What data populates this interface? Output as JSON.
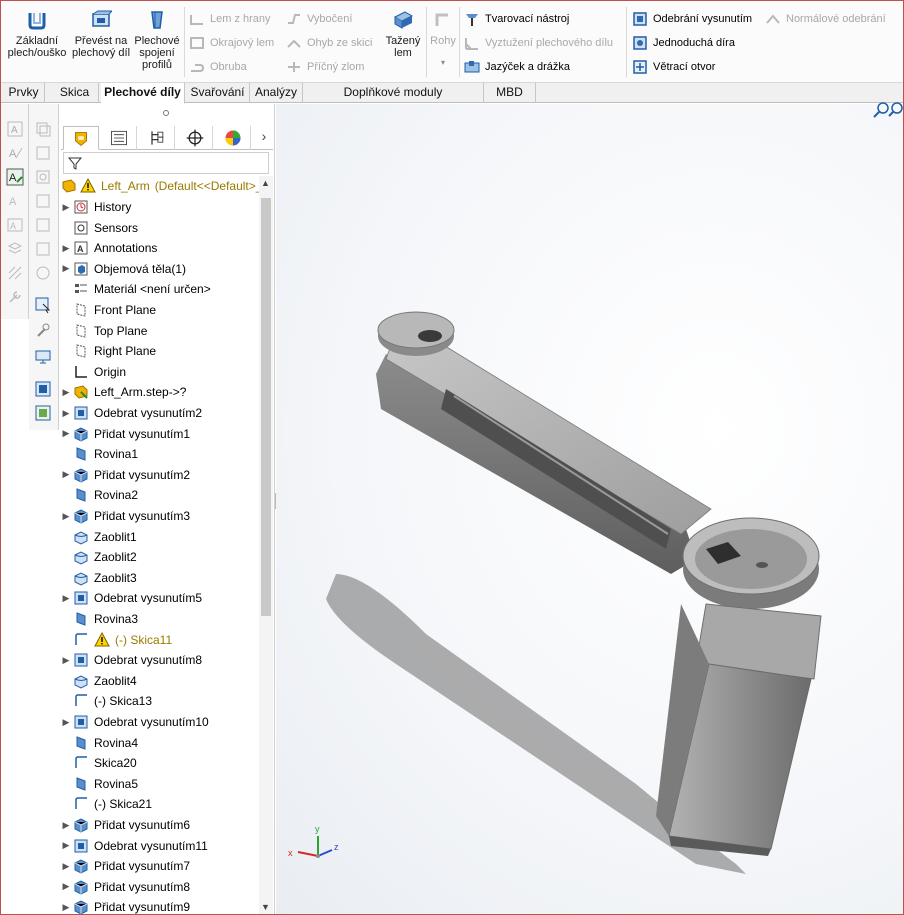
{
  "ribbon": {
    "big_buttons": [
      {
        "label": "Základní plech/ouško",
        "icon": "base-flange-icon"
      },
      {
        "label": "Převést na plechový díl",
        "icon": "convert-to-sheet-metal-icon"
      },
      {
        "label": "Plechové spojení profilů",
        "icon": "lofted-bend-icon"
      }
    ],
    "group1": [
      {
        "label": "Lem z hrany",
        "icon": "edge-flange-icon",
        "enabled": false
      },
      {
        "label": "Okrajový lem",
        "icon": "miter-flange-icon",
        "enabled": false
      },
      {
        "label": "Obruba",
        "icon": "hem-icon",
        "enabled": false
      }
    ],
    "group2": [
      {
        "label": "Vybočení",
        "icon": "jog-icon",
        "enabled": false
      },
      {
        "label": "Ohyb ze skici",
        "icon": "sketched-bend-icon",
        "enabled": false
      },
      {
        "label": "Příčný zlom",
        "icon": "cross-break-icon",
        "enabled": false
      }
    ],
    "tazeny_lem": {
      "label": "Tažený lem",
      "icon": "swept-flange-icon"
    },
    "rohy": {
      "label": "Rohy",
      "icon": "corners-icon",
      "enabled": false
    },
    "group3": [
      {
        "label": "Tvarovací nástroj",
        "icon": "forming-tool-icon",
        "enabled": true
      },
      {
        "label": "Vyztužení plechového dílu",
        "icon": "sheet-metal-gusset-icon",
        "enabled": false
      },
      {
        "label": "Jazýček a drážka",
        "icon": "tab-and-slot-icon",
        "enabled": true
      }
    ],
    "group4": [
      {
        "label": "Odebrání vysunutím",
        "icon": "extruded-cut-icon",
        "enabled": true
      },
      {
        "label": "Jednoduchá díra",
        "icon": "simple-hole-icon",
        "enabled": true
      },
      {
        "label": "Větrací otvor",
        "icon": "vent-icon",
        "enabled": true
      }
    ],
    "normal_cut": {
      "label": "Normálové odebrání",
      "icon": "normal-cut-icon",
      "enabled": false
    }
  },
  "tabs": [
    {
      "label": "Prvky",
      "active": false
    },
    {
      "label": "Skica",
      "active": false
    },
    {
      "label": "Plechové díly",
      "active": true
    },
    {
      "label": "Svařování",
      "active": false
    },
    {
      "label": "Analýzy",
      "active": false
    },
    {
      "label": "Doplňkové moduly SOLIDWORKS",
      "active": false
    },
    {
      "label": "MBD",
      "active": false
    }
  ],
  "tree": {
    "root": {
      "label": "Left_Arm",
      "config": "(Default<<Default>_"
    },
    "items": [
      {
        "label": "History",
        "icon": "history-icon",
        "arrow": true
      },
      {
        "label": "Sensors",
        "icon": "sensors-icon",
        "arrow": false
      },
      {
        "label": "Annotations",
        "icon": "annotations-icon",
        "arrow": true
      },
      {
        "label": "Objemová těla(1)",
        "icon": "solid-bodies-icon",
        "arrow": true
      },
      {
        "label": "Materiál <není určen>",
        "icon": "material-icon",
        "arrow": false
      },
      {
        "label": "Front Plane",
        "icon": "plane-icon",
        "arrow": false
      },
      {
        "label": "Top Plane",
        "icon": "plane-icon",
        "arrow": false
      },
      {
        "label": "Right Plane",
        "icon": "plane-icon",
        "arrow": false
      },
      {
        "label": "Origin",
        "icon": "origin-icon",
        "arrow": false
      },
      {
        "label": "Left_Arm.step->?",
        "icon": "imported-part-icon",
        "arrow": true
      },
      {
        "label": "Odebrat vysunutím2",
        "icon": "cut-extrude-icon",
        "arrow": true
      },
      {
        "label": "Přidat vysunutím1",
        "icon": "boss-extrude-icon",
        "arrow": true
      },
      {
        "label": "Rovina1",
        "icon": "plane-feature-icon",
        "arrow": false
      },
      {
        "label": "Přidat vysunutím2",
        "icon": "boss-extrude-icon",
        "arrow": true
      },
      {
        "label": "Rovina2",
        "icon": "plane-feature-icon",
        "arrow": false
      },
      {
        "label": "Přidat vysunutím3",
        "icon": "boss-extrude-icon",
        "arrow": true
      },
      {
        "label": "Zaoblit1",
        "icon": "fillet-icon",
        "arrow": false
      },
      {
        "label": "Zaoblit2",
        "icon": "fillet-icon",
        "arrow": false
      },
      {
        "label": "Zaoblit3",
        "icon": "fillet-icon",
        "arrow": false
      },
      {
        "label": "Odebrat vysunutím5",
        "icon": "cut-extrude-icon",
        "arrow": true
      },
      {
        "label": "Rovina3",
        "icon": "plane-feature-icon",
        "arrow": false
      },
      {
        "label": "(-) Skica11",
        "icon": "sketch-icon",
        "arrow": false,
        "warning": true
      },
      {
        "label": "Odebrat vysunutím8",
        "icon": "cut-extrude-icon",
        "arrow": true
      },
      {
        "label": "Zaoblit4",
        "icon": "fillet-icon",
        "arrow": false
      },
      {
        "label": "(-) Skica13",
        "icon": "sketch-icon",
        "arrow": false
      },
      {
        "label": "Odebrat vysunutím10",
        "icon": "cut-extrude-icon",
        "arrow": true
      },
      {
        "label": "Rovina4",
        "icon": "plane-feature-icon",
        "arrow": false
      },
      {
        "label": "Skica20",
        "icon": "sketch-icon",
        "arrow": false
      },
      {
        "label": "Rovina5",
        "icon": "plane-feature-icon",
        "arrow": false
      },
      {
        "label": "(-) Skica21",
        "icon": "sketch-icon",
        "arrow": false
      },
      {
        "label": "Přidat vysunutím6",
        "icon": "boss-extrude-icon",
        "arrow": true
      },
      {
        "label": "Odebrat vysunutím11",
        "icon": "cut-extrude-icon",
        "arrow": true
      },
      {
        "label": "Přidat vysunutím7",
        "icon": "boss-extrude-icon",
        "arrow": true
      },
      {
        "label": "Přidat vysunutím8",
        "icon": "boss-extrude-icon",
        "arrow": true
      },
      {
        "label": "Přidat vysunutím9",
        "icon": "boss-extrude-icon",
        "arrow": true
      }
    ]
  },
  "triad": {
    "x": "x",
    "y": "y",
    "z": "z"
  },
  "colors": {
    "accent": "#1f5fa8",
    "warning": "#e8b700",
    "warning_text": "#9a7a00",
    "part_gray": "#9a9a9a"
  }
}
